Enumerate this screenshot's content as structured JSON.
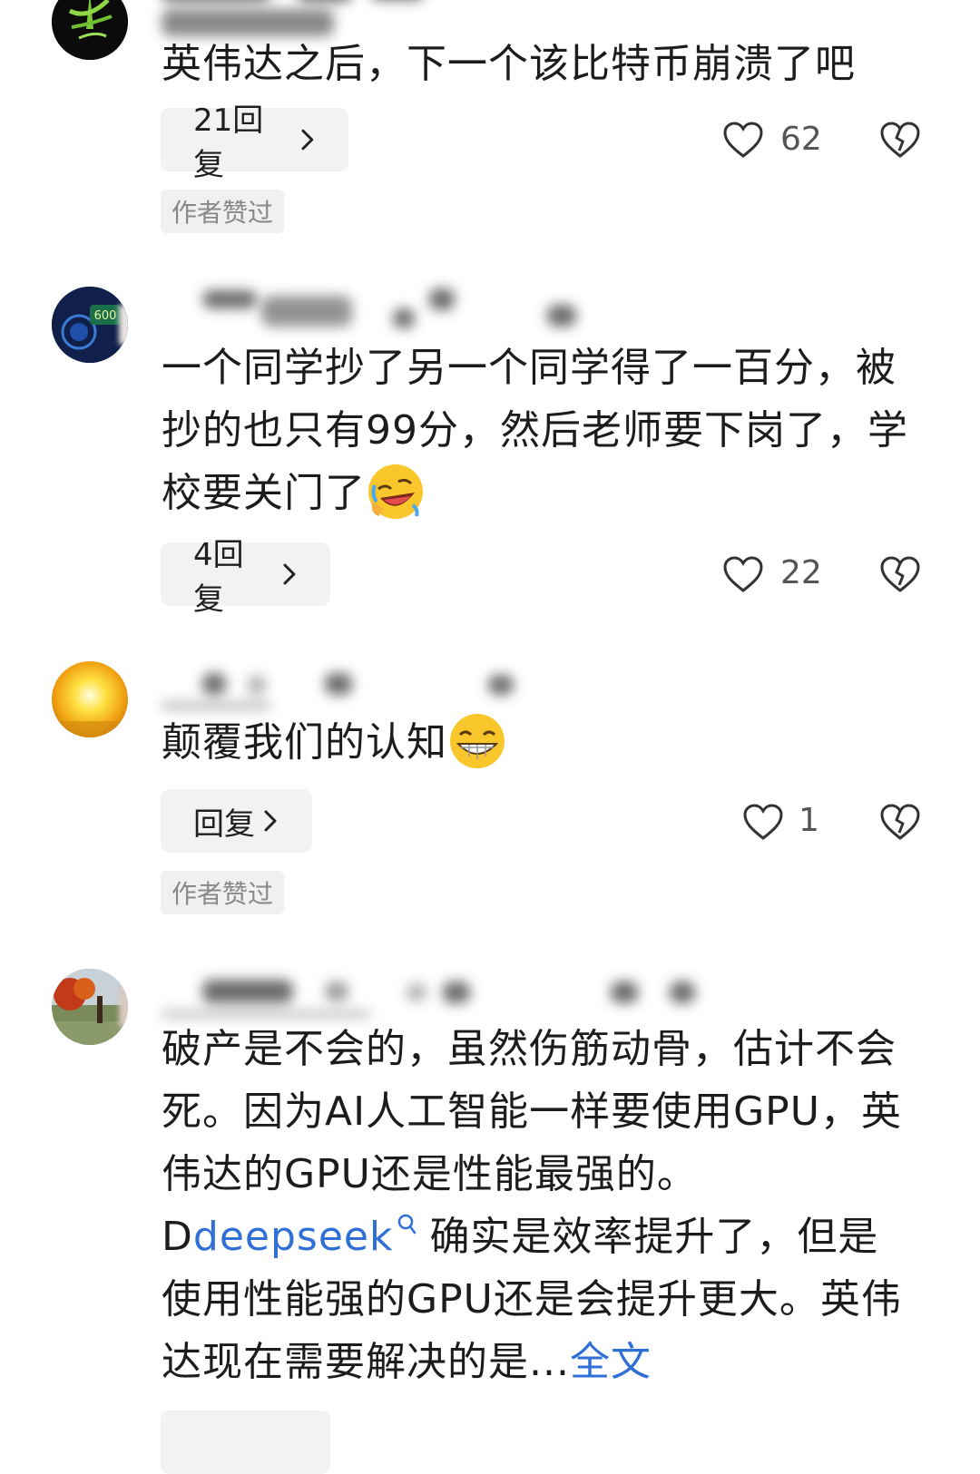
{
  "comments": [
    {
      "id": "c1",
      "text": "英伟达之后，下一个该比特币崩溃了吧",
      "reply_label": "21回复",
      "likes": "62",
      "author_badge": "作者赞过"
    },
    {
      "id": "c2",
      "text": "一个同学抄了另一个同学得了一百分，被抄的也只有99分，然后老师要下岗了，学校要关门了",
      "reply_label": "4回复",
      "likes": "22"
    },
    {
      "id": "c3",
      "text": "颠覆我们的认知",
      "reply_label": "回复",
      "likes": "1",
      "author_badge": "作者赞过"
    },
    {
      "id": "c4",
      "text_part1": "破产是不会的，虽然伤筋动骨，估计不会死。因为AI人工智能一样要使用GPU，英伟达的GPU还是性能最强的。D",
      "link_text": "deepseek",
      "text_part2": "确实是效率提升了，但是使用性能强的GPU还是会提升更大。英伟达现在需要解决的是...",
      "full_text_link": "全文"
    }
  ],
  "colors": {
    "link": "#2f6fd6",
    "button_bg": "#f2f2f3",
    "badge_bg": "#f0f0f2"
  },
  "icons": [
    "heart-icon",
    "broken-heart-icon",
    "chevron-right-icon",
    "search-icon"
  ]
}
